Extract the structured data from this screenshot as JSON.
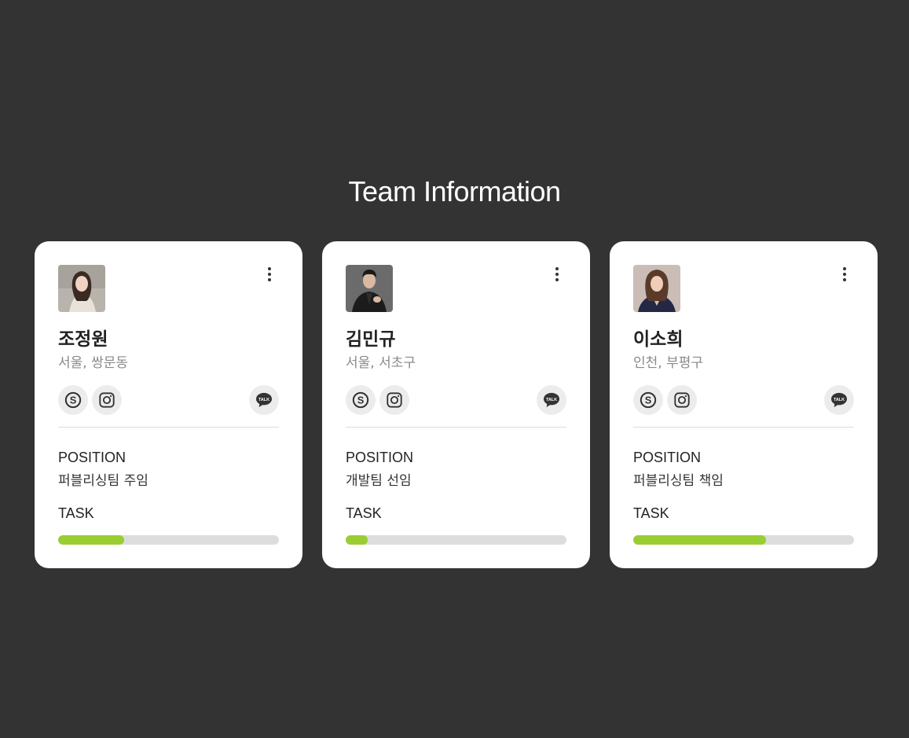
{
  "page": {
    "title": "Team Information"
  },
  "colors": {
    "background": "#333333",
    "card": "#ffffff",
    "progress": "#9acd32",
    "track": "#dddddd"
  },
  "icons": {
    "menu": "more-vertical-icon",
    "skype": "skype-icon",
    "instagram": "instagram-icon",
    "talk": "kakaotalk-icon",
    "talk_text": "TALK"
  },
  "labels": {
    "position": "POSITION",
    "task": "TASK"
  },
  "members": [
    {
      "name": "조정원",
      "location": "서울, 쌍문동",
      "position": "퍼블리싱팀 주임",
      "task_progress": 0.3
    },
    {
      "name": "김민규",
      "location": "서울, 서초구",
      "position": "개발팀 선임",
      "task_progress": 0.1
    },
    {
      "name": "이소희",
      "location": "인천, 부평구",
      "position": "퍼블리싱팀 책임",
      "task_progress": 0.6
    }
  ]
}
